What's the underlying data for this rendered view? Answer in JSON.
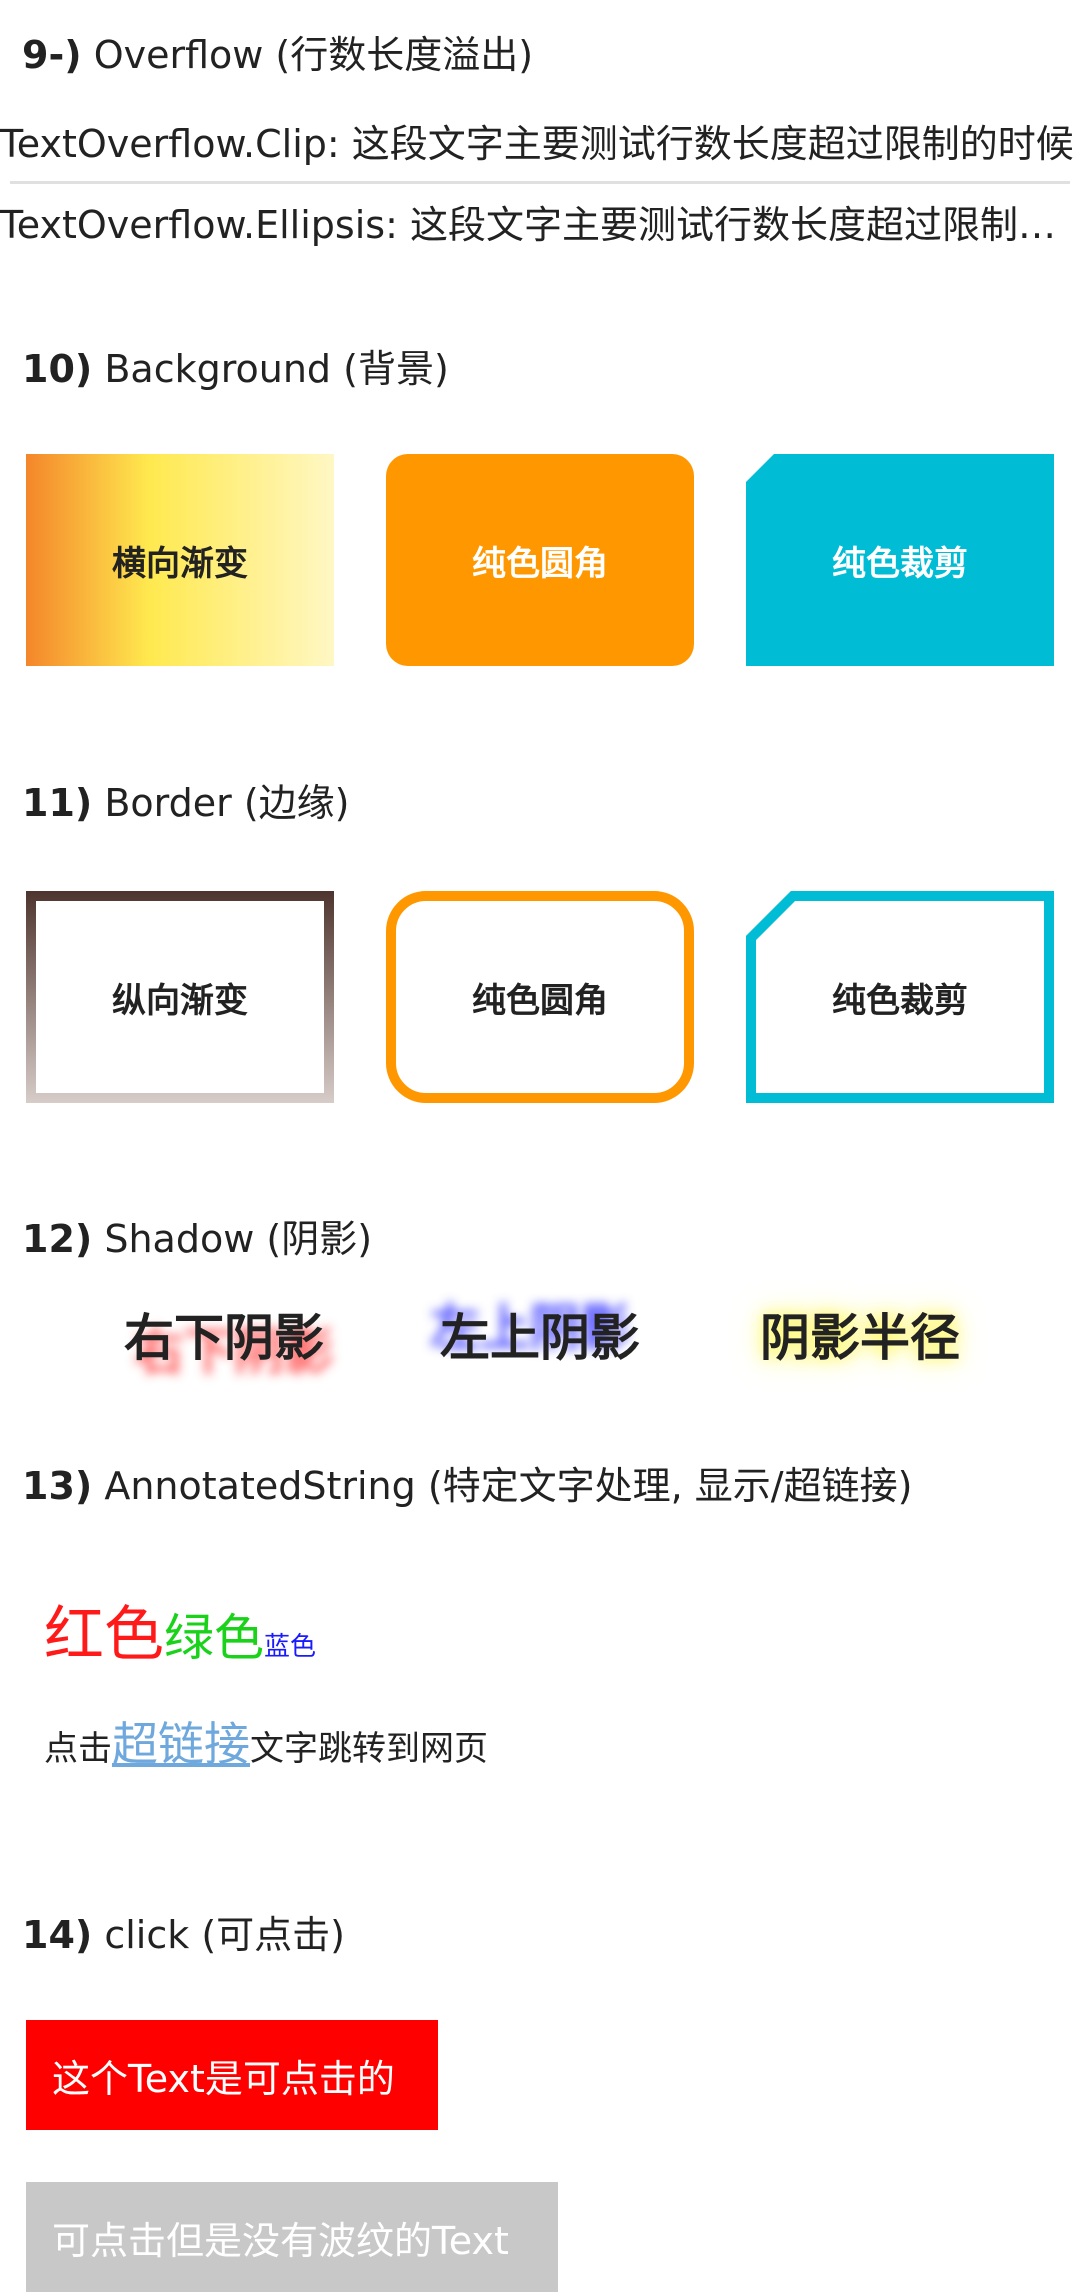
{
  "section9": {
    "num": "9-)",
    "title": "Overflow (行数长度溢出)",
    "clip_text": "TextOverflow.Clip: 这段文字主要测试行数长度超过限制的时候会怎样显示",
    "ellipsis_text": "TextOverflow.Ellipsis: 这段文字主要测试行数长度超过限制的时候会怎样显示"
  },
  "section10": {
    "num": "10)",
    "title": "Background (背景)",
    "boxes": [
      "横向渐变",
      "纯色圆角",
      "纯色裁剪"
    ]
  },
  "section11": {
    "num": "11)",
    "title": "Border (边缘)",
    "boxes": [
      "纵向渐变",
      "纯色圆角",
      "纯色裁剪"
    ]
  },
  "section12": {
    "num": "12)",
    "title": "Shadow (阴影)",
    "items": [
      "右下阴影",
      "左上阴影",
      "阴影半径"
    ]
  },
  "section13": {
    "num": "13)",
    "title": "AnnotatedString (特定文字处理, 显示/超链接)",
    "red": "红色",
    "green": "绿色",
    "blue": "蓝色",
    "link_prefix": "点击",
    "link_text": "超链接",
    "link_suffix": "文字跳转到网页"
  },
  "section14": {
    "num": "14)",
    "title": "click (可点击)",
    "button_clickable": "这个Text是可点击的",
    "button_no_ripple": "可点击但是没有波纹的Text"
  },
  "colors": {
    "orange": "#ff9800",
    "cyan": "#00bcd4",
    "red_button": "#ff0000",
    "grey_button": "#c8c8c8",
    "link": "#6fa8dc"
  }
}
